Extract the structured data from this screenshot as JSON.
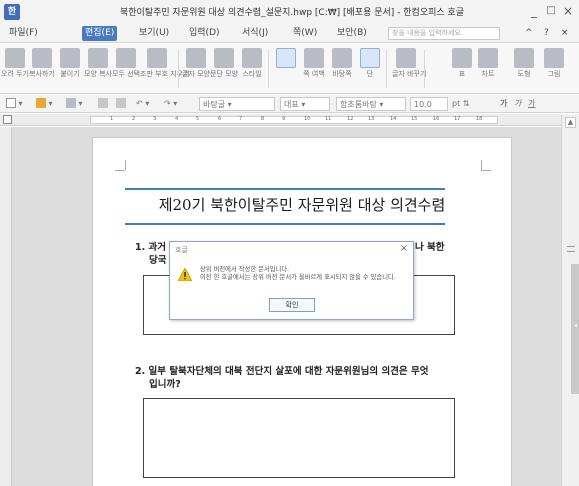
{
  "window": {
    "title": "북한이탈주민 자문위원 대상 의견수렴_설문지.hwp [C:₩] [배포용 문서] - 한컴오피스 호글",
    "app_icon_glyph": "한",
    "minimize": "_",
    "maximize": "□",
    "close": "×"
  },
  "menu": {
    "items": [
      "파일(F)",
      "편집(E)",
      "보기(U)",
      "입력(D)",
      "서식(J)",
      "쪽(W)",
      "보안(B)"
    ],
    "active_index": 1,
    "search_placeholder": "찾을 내용을 입력하세요.",
    "ribbon_toggle": "^",
    "help": "?",
    "close": "×"
  },
  "ribbon": {
    "buttons": [
      {
        "icon": "scissors-icon",
        "label": "오려 두기"
      },
      {
        "icon": "copy-icon",
        "label": "복사하기"
      },
      {
        "icon": "paste-icon",
        "label": "붙이기"
      },
      {
        "icon": "format-copy-icon",
        "label": "모양 복사"
      },
      {
        "icon": "select-all-icon",
        "label": "모두 선택"
      },
      {
        "icon": "clear-format-icon",
        "label": "조판 부호 지우기"
      },
      {
        "icon": "char-shape-icon",
        "label": "글자 모양"
      },
      {
        "icon": "para-shape-icon",
        "label": "문단 모양"
      },
      {
        "icon": "style-icon",
        "label": "스타일"
      },
      {
        "icon": "page-icon",
        "label": ""
      },
      {
        "icon": "column-icon",
        "label": "쪽 여백"
      },
      {
        "icon": "background-icon",
        "label": "바탕쪽"
      },
      {
        "icon": "multi-column-icon",
        "label": "단"
      },
      {
        "icon": "glyph-icon",
        "label": "글자 바꾸기"
      },
      {
        "icon": "table-icon",
        "label": "표"
      },
      {
        "icon": "chart-icon",
        "label": "차트"
      },
      {
        "icon": "shape-icon",
        "label": "도형"
      },
      {
        "icon": "picture-icon",
        "label": "그림"
      }
    ]
  },
  "format_toolbar": {
    "style_name": "바탕글",
    "language": "대표",
    "font_name": "함초롬바탕",
    "font_size": "10.0",
    "font_unit": "pt",
    "bold": "가",
    "italic": "가",
    "underline": "가"
  },
  "ruler": {
    "numbers": [
      "1",
      "2",
      "3",
      "4",
      "5",
      "6",
      "7",
      "8",
      "9",
      "10",
      "11",
      "12",
      "13",
      "14",
      "15",
      "16",
      "17",
      "18"
    ]
  },
  "document": {
    "title": "제20기 북한이탈주민 자문위원 대상 의견수렴",
    "q1_line1": "1. 과거",
    "q1_tail": "나 북한",
    "q1_line2": "당국",
    "q2_line1": "2. 일부 탈북자단체의 대북 전단지 살포에 대한 자문위원님의 의견은 무엇",
    "q2_line2": "입니까?"
  },
  "dialog": {
    "title": "호글",
    "message_line1": "상위 버전에서 작성한 문서입니다.",
    "message_line2": "이전 한 호글에서는 상위 버전 문서가 올바르게 표시되지 않을 수 있습니다.",
    "ok_label": "확인",
    "close": "×"
  }
}
